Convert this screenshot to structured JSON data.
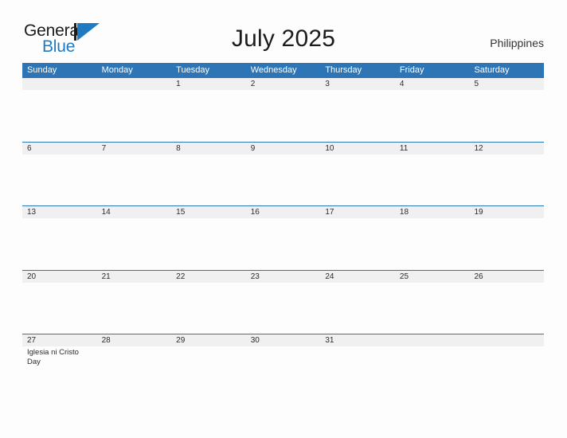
{
  "logo": {
    "word_primary": "General",
    "word_secondary": "Blue",
    "mark_icon": "blue-triangle-flag-icon"
  },
  "header": {
    "title": "July 2025",
    "region": "Philippines"
  },
  "colors": {
    "header_blue": "#2e75b6",
    "row_band_gray": "#f0f0f0",
    "page_background": "#fdfdfd",
    "logo_blue": "#1f7ac4",
    "text_dark": "#1b1b1b"
  },
  "calendar": {
    "weekdays": [
      "Sunday",
      "Monday",
      "Tuesday",
      "Wednesday",
      "Thursday",
      "Friday",
      "Saturday"
    ],
    "weeks": [
      {
        "days": [
          {
            "number": "",
            "event": ""
          },
          {
            "number": "",
            "event": ""
          },
          {
            "number": "1",
            "event": ""
          },
          {
            "number": "2",
            "event": ""
          },
          {
            "number": "3",
            "event": ""
          },
          {
            "number": "4",
            "event": ""
          },
          {
            "number": "5",
            "event": ""
          }
        ]
      },
      {
        "days": [
          {
            "number": "6",
            "event": ""
          },
          {
            "number": "7",
            "event": ""
          },
          {
            "number": "8",
            "event": ""
          },
          {
            "number": "9",
            "event": ""
          },
          {
            "number": "10",
            "event": ""
          },
          {
            "number": "11",
            "event": ""
          },
          {
            "number": "12",
            "event": ""
          }
        ]
      },
      {
        "days": [
          {
            "number": "13",
            "event": ""
          },
          {
            "number": "14",
            "event": ""
          },
          {
            "number": "15",
            "event": ""
          },
          {
            "number": "16",
            "event": ""
          },
          {
            "number": "17",
            "event": ""
          },
          {
            "number": "18",
            "event": ""
          },
          {
            "number": "19",
            "event": ""
          }
        ]
      },
      {
        "days": [
          {
            "number": "20",
            "event": ""
          },
          {
            "number": "21",
            "event": ""
          },
          {
            "number": "22",
            "event": ""
          },
          {
            "number": "23",
            "event": ""
          },
          {
            "number": "24",
            "event": ""
          },
          {
            "number": "25",
            "event": ""
          },
          {
            "number": "26",
            "event": ""
          }
        ]
      },
      {
        "days": [
          {
            "number": "27",
            "event": "Iglesia ni Cristo Day"
          },
          {
            "number": "28",
            "event": ""
          },
          {
            "number": "29",
            "event": ""
          },
          {
            "number": "30",
            "event": ""
          },
          {
            "number": "31",
            "event": ""
          },
          {
            "number": "",
            "event": ""
          },
          {
            "number": "",
            "event": ""
          }
        ]
      }
    ]
  }
}
